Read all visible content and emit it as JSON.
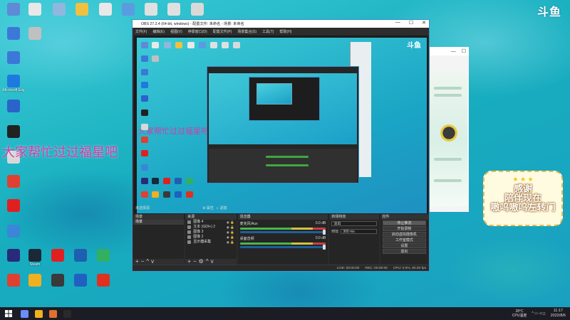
{
  "desktop": {
    "icons": [
      {
        "label": "",
        "color": "#5e8ad6"
      },
      {
        "label": "",
        "color": "#e8e8e8"
      },
      {
        "label": "",
        "color": "#8fb7e0"
      },
      {
        "label": "",
        "color": "#f0c040"
      },
      {
        "label": "",
        "color": "#e8e8e8"
      },
      {
        "label": "",
        "color": "#5b9be0"
      },
      {
        "label": "",
        "color": "#e0e0e0"
      },
      {
        "label": "",
        "color": "#e0e0e0"
      },
      {
        "label": "",
        "color": "#d9d9d9"
      },
      {
        "label": "",
        "color": "#3c78d8"
      },
      {
        "label": "",
        "color": "#c0c0c0"
      },
      {
        "label": "",
        "color": "#3c78d8"
      },
      {
        "label": "Microsoft Edge",
        "color": "#1f7ae0"
      },
      {
        "label": "",
        "color": "#2a63c9"
      },
      {
        "label": "",
        "color": "#222222"
      },
      {
        "label": "",
        "color": "#d8d8d8"
      },
      {
        "label": "",
        "color": "#e04030"
      },
      {
        "label": "",
        "color": "#e02020"
      },
      {
        "label": "",
        "color": "#3b86d8"
      },
      {
        "label": "",
        "color": "#2a2a7a"
      },
      {
        "label": "Steam",
        "color": "#1b2838"
      },
      {
        "label": "",
        "color": "#e02020"
      },
      {
        "label": "",
        "color": "#1e5fb0"
      },
      {
        "label": "",
        "color": "#30b060"
      },
      {
        "label": "",
        "color": "#e04030"
      },
      {
        "label": "",
        "color": "#f0b020"
      },
      {
        "label": "",
        "color": "#3a3a3a"
      },
      {
        "label": "",
        "color": "#2060c0"
      },
      {
        "label": "",
        "color": "#e03020"
      }
    ],
    "banner_text": "大家帮忙过过福星吧",
    "logo_text": "斗鱼"
  },
  "sticker": {
    "line1": "感谢",
    "line2": "陪伴现在",
    "line3": "嗷呜嗷呜左转门"
  },
  "obs": {
    "title": "OBS 27.2.4 (64-bit, windows) - 配置文件: 未命名 - 场景: 未命名",
    "window_controls": {
      "minimize": "—",
      "maximize": "☐",
      "close": "✕"
    },
    "menu": [
      "文件(F)",
      "编辑(E)",
      "视图(V)",
      "停靠窗口(D)",
      "配置文件(P)",
      "场景集合(S)",
      "工具(T)",
      "帮助(H)"
    ],
    "preview_banner": "大家帮忙过过福星吧",
    "preview_logo": "斗鱼",
    "preview_tabs": [
      "未选择源",
      "属性",
      "滤镜"
    ],
    "scenes_header": "场景",
    "scenes": [
      "场景"
    ],
    "sources_header": "来源",
    "sources": [
      {
        "label": "图像 4"
      },
      {
        "label": "文本 (GDI+) 2"
      },
      {
        "label": "图像 3"
      },
      {
        "label": "图像 2"
      },
      {
        "label": "显示器采集"
      }
    ],
    "mixer_header": "混音器",
    "mixer": [
      {
        "name": "麦克风/Aux",
        "level": "0.0 dB"
      },
      {
        "name": "桌面音频",
        "level": "0.0 dB"
      }
    ],
    "transitions_header": "转场特效",
    "transition_type": "淡出",
    "transition_duration_label": "时长",
    "transition_duration": "300 ms",
    "controls_header": "控件",
    "controls": [
      "停止推流",
      "开始录制",
      "启动虚拟摄像机",
      "工作室模式",
      "设置",
      "退出"
    ],
    "status": {
      "live_label": "LIVE:",
      "live_time": "00:00:00",
      "rec_label": "REC:",
      "rec_time": "00:00:00",
      "cpu": "CPU: 0.0%, 60.00 fps"
    }
  },
  "taskbar": {
    "apps": [
      {
        "color": "#6a8cff"
      },
      {
        "color": "#f0b020"
      },
      {
        "color": "#e07030"
      },
      {
        "color": "#2a2a2a"
      }
    ],
    "weather": "28°C",
    "weather_sub": "CPU温度",
    "tray_icons": "^ ▭ ◁ ◻",
    "time": "11:17",
    "date": "2022/8/6"
  }
}
